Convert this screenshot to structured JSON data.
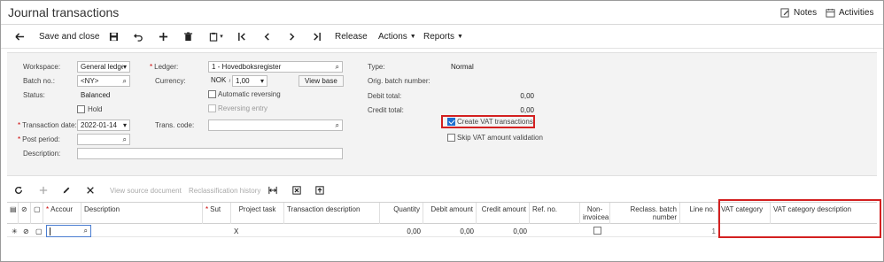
{
  "title": "Journal transactions",
  "header_links": {
    "notes": "Notes",
    "activities": "Activities"
  },
  "toolbar": {
    "save_close": "Save and close",
    "release": "Release",
    "actions": "Actions",
    "reports": "Reports"
  },
  "form": {
    "workspace_label": "Workspace:",
    "workspace_value": "General ledge",
    "batch_label": "Batch no.:",
    "batch_value": "<NY>",
    "status_label": "Status:",
    "status_value": "Balanced",
    "hold_label": "Hold",
    "trans_date_label": "Transaction date:",
    "trans_date_value": "2022-01-14",
    "post_period_label": "Post period:",
    "post_period_value": "",
    "description_label": "Description:",
    "description_value": "",
    "ledger_label": "Ledger:",
    "ledger_value": "1 - Hovedboksregister",
    "currency_label": "Currency:",
    "currency_code": "NOK",
    "currency_rate": "1,00",
    "view_base": "View base",
    "auto_reversing": "Automatic reversing",
    "reversing_entry": "Reversing entry",
    "trans_code_label": "Trans. code:",
    "trans_code_value": "",
    "type_label": "Type:",
    "type_value": "Normal",
    "orig_batch_label": "Orig. batch number:",
    "orig_batch_value": "",
    "debit_total_label": "Debit total:",
    "debit_total_value": "0,00",
    "credit_total_label": "Credit total:",
    "credit_total_value": "0,00",
    "create_vat": "Create VAT transactions",
    "create_vat_checked": true,
    "skip_vat": "Skip VAT amount validation"
  },
  "grid_toolbar": {
    "view_source": "View source document",
    "reclass_history": "Reclassification history"
  },
  "grid": {
    "columns": {
      "account": "Accour",
      "description": "Description",
      "sub": "Sut",
      "project_task": "Project task",
      "trans_desc": "Transaction description",
      "quantity": "Quantity",
      "debit": "Debit amount",
      "credit": "Credit amount",
      "ref_no": "Ref. no.",
      "non_invoiceable": "Non-invoicea",
      "reclass_batch": "Reclass. batch number",
      "line_no": "Line no.",
      "vat_category": "VAT category",
      "vat_cat_desc": "VAT category description"
    },
    "row": {
      "project_task": "X",
      "quantity": "0,00",
      "debit": "0,00",
      "credit": "0,00",
      "line_no": "1"
    }
  },
  "colors": {
    "highlight": "#d32020",
    "checkbox": "#1e6fd0"
  }
}
